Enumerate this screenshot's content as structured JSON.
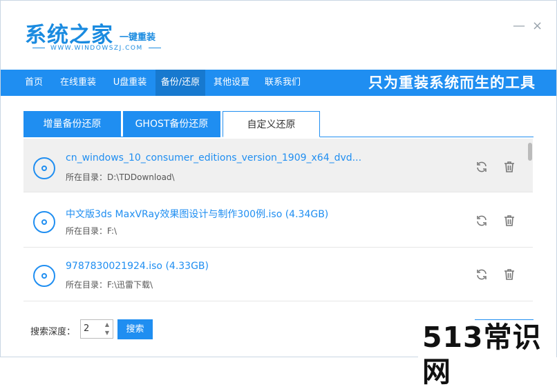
{
  "app": {
    "logo_main": "系统之家",
    "logo_sub": "一键重装",
    "logo_url": "WWW.WINDOWSZJ.COM",
    "minimize": "—",
    "close": "×"
  },
  "nav": {
    "items": [
      {
        "label": "首页"
      },
      {
        "label": "在线重装"
      },
      {
        "label": "U盘重装"
      },
      {
        "label": "备份/还原",
        "active": true
      },
      {
        "label": "其他设置"
      },
      {
        "label": "联系我们"
      }
    ],
    "slogan": "只为重装系统而生的工具"
  },
  "tabs": [
    {
      "label": "增量备份还原"
    },
    {
      "label": "GHOST备份还原"
    },
    {
      "label": "自定义还原",
      "active": true
    }
  ],
  "list": {
    "items": [
      {
        "name": "cn_windows_10_consumer_editions_version_1909_x64_dvd...",
        "dir": "所在目录：D:\\TDDownload\\",
        "selected": true
      },
      {
        "name": "中文版3ds MaxVRay效果图设计与制作300例.iso (4.34GB)",
        "dir": "所在目录：F:\\"
      },
      {
        "name": "9787830021924.iso (4.33GB)",
        "dir": "所在目录：F:\\迅雷下载\\"
      }
    ],
    "action_icons": [
      "refresh-icon",
      "trash-icon"
    ]
  },
  "bottom": {
    "depth_label": "搜索深度：",
    "depth_value": "2",
    "search_button": "搜索"
  },
  "watermark": "513常识网",
  "colors": {
    "accent": "#1f8ef1",
    "nav_active": "#1779cf"
  }
}
